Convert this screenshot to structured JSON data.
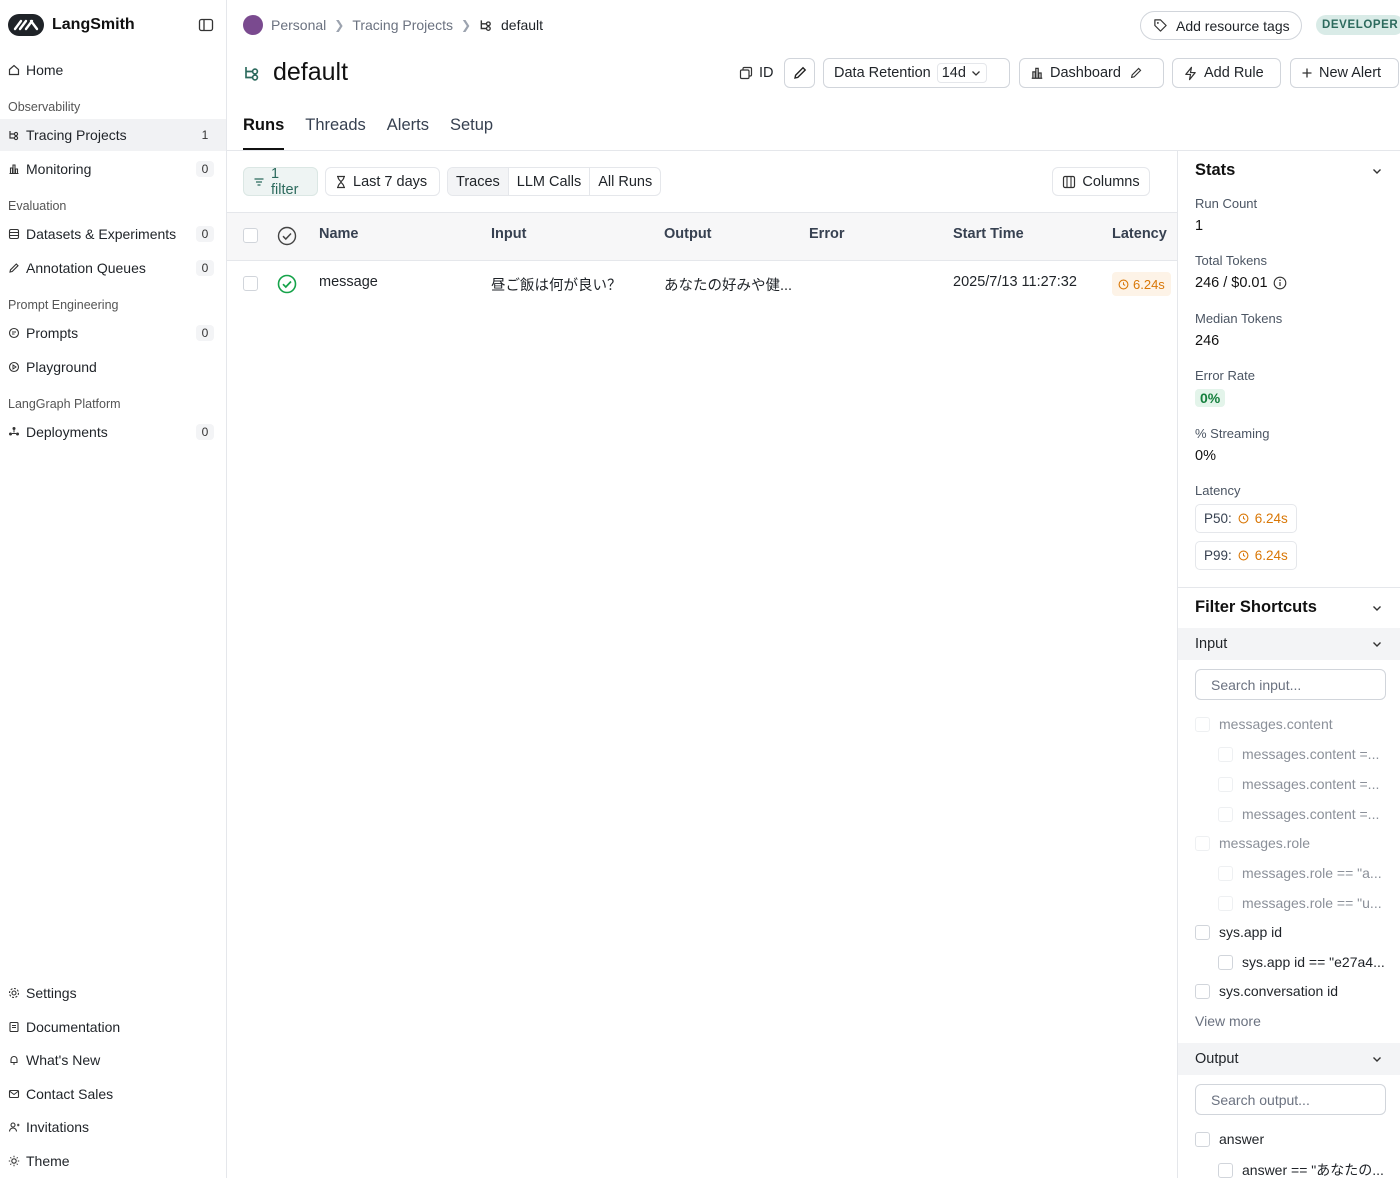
{
  "app": {
    "name": "LangSmith",
    "logo_text": "LC"
  },
  "sidebar": {
    "home": "Home",
    "sections": [
      {
        "label": "Observability",
        "items": [
          {
            "label": "Tracing Projects",
            "count": "1"
          },
          {
            "label": "Monitoring",
            "count": "0"
          }
        ]
      },
      {
        "label": "Evaluation",
        "items": [
          {
            "label": "Datasets & Experiments",
            "count": "0"
          },
          {
            "label": "Annotation Queues",
            "count": "0"
          }
        ]
      },
      {
        "label": "Prompt Engineering",
        "items": [
          {
            "label": "Prompts",
            "count": "0"
          },
          {
            "label": "Playground",
            "count": ""
          }
        ]
      },
      {
        "label": "LangGraph Platform",
        "items": [
          {
            "label": "Deployments",
            "count": "0"
          }
        ]
      }
    ],
    "bottom": [
      "Settings",
      "Documentation",
      "What's New",
      "Contact Sales",
      "Invitations",
      "Theme"
    ]
  },
  "breadcrumb": {
    "workspace": "Personal",
    "section": "Tracing Projects",
    "current": "default"
  },
  "header": {
    "add_tags": "Add resource tags",
    "badge": "DEVELOPER",
    "title": "default",
    "id_label": "ID",
    "retention_label": "Data Retention",
    "retention_value": "14d",
    "dashboard": "Dashboard",
    "add_rule": "Add Rule",
    "new_alert": "New Alert"
  },
  "tabs": [
    "Runs",
    "Threads",
    "Alerts",
    "Setup"
  ],
  "toolbar": {
    "filter": "1 filter",
    "time_range": "Last 7 days",
    "run_types": [
      "Traces",
      "LLM Calls",
      "All Runs"
    ],
    "selected_run_type": "Traces",
    "columns": "Columns"
  },
  "table": {
    "headers": {
      "name": "Name",
      "input": "Input",
      "output": "Output",
      "error": "Error",
      "start_time": "Start Time",
      "latency": "Latency"
    },
    "rows": [
      {
        "name": "message",
        "input": "昼ご飯は何が良い？",
        "output": "あなたの好みや健...",
        "error": "",
        "start_time": "2025/7/13 11:27:32",
        "latency": "6.24s",
        "status": "success"
      }
    ]
  },
  "stats": {
    "title": "Stats",
    "run_count_label": "Run Count",
    "run_count": "1",
    "total_tokens_label": "Total Tokens",
    "total_tokens": "246 / $0.01",
    "median_tokens_label": "Median Tokens",
    "median_tokens": "246",
    "error_rate_label": "Error Rate",
    "error_rate": "0%",
    "streaming_label": "% Streaming",
    "streaming": "0%",
    "latency_label": "Latency",
    "p50_label": "P50:",
    "p50": "6.24s",
    "p99_label": "P99:",
    "p99": "6.24s"
  },
  "filter_shortcuts": {
    "title": "Filter Shortcuts",
    "input": {
      "label": "Input",
      "placeholder": "Search input...",
      "items": [
        {
          "text": "messages.content",
          "level": 0,
          "muted": true
        },
        {
          "text": "messages.content =...",
          "level": 1,
          "muted": true
        },
        {
          "text": "messages.content =...",
          "level": 1,
          "muted": true
        },
        {
          "text": "messages.content =...",
          "level": 1,
          "muted": true
        },
        {
          "text": "messages.role",
          "level": 0,
          "muted": true
        },
        {
          "text": "messages.role == \"a...",
          "level": 1,
          "muted": true
        },
        {
          "text": "messages.role == \"u...",
          "level": 1,
          "muted": true
        },
        {
          "text": "sys.app id",
          "level": 0,
          "muted": false
        },
        {
          "text": "sys.app id == \"e27a4...",
          "level": 1,
          "muted": false
        },
        {
          "text": "sys.conversation id",
          "level": 0,
          "muted": false
        }
      ],
      "view_more": "View more"
    },
    "output": {
      "label": "Output",
      "placeholder": "Search output...",
      "items": [
        {
          "text": "answer",
          "level": 0,
          "muted": false
        },
        {
          "text": "answer == \"あなたの...",
          "level": 1,
          "muted": false
        }
      ]
    }
  },
  "colors": {
    "accent": "#2c6a5d",
    "latency": "#d97706",
    "success": "#16a34a"
  }
}
